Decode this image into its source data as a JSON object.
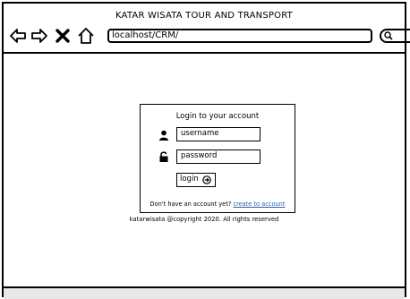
{
  "window": {
    "title": "KATAR WISATA TOUR AND TRANSPORT",
    "address": "localhost/CRM/"
  },
  "icons": {
    "back": "back-arrow-icon",
    "forward": "forward-arrow-icon",
    "stop": "close-icon",
    "home": "home-icon",
    "search": "search-icon",
    "user": "user-icon",
    "lock": "lock-icon",
    "login_arrow": "circle-arrow-right-icon"
  },
  "login": {
    "heading": "Login to your account",
    "username_value": "username",
    "password_value": "password",
    "button_label": "login",
    "signup_prompt": "Don't have an account yet?",
    "signup_link": "create to account"
  },
  "footer": {
    "copyright": "katarwisata @copyright 2020. All rights reserved"
  },
  "colors": {
    "link": "#1e5fd0",
    "border": "#000000"
  }
}
